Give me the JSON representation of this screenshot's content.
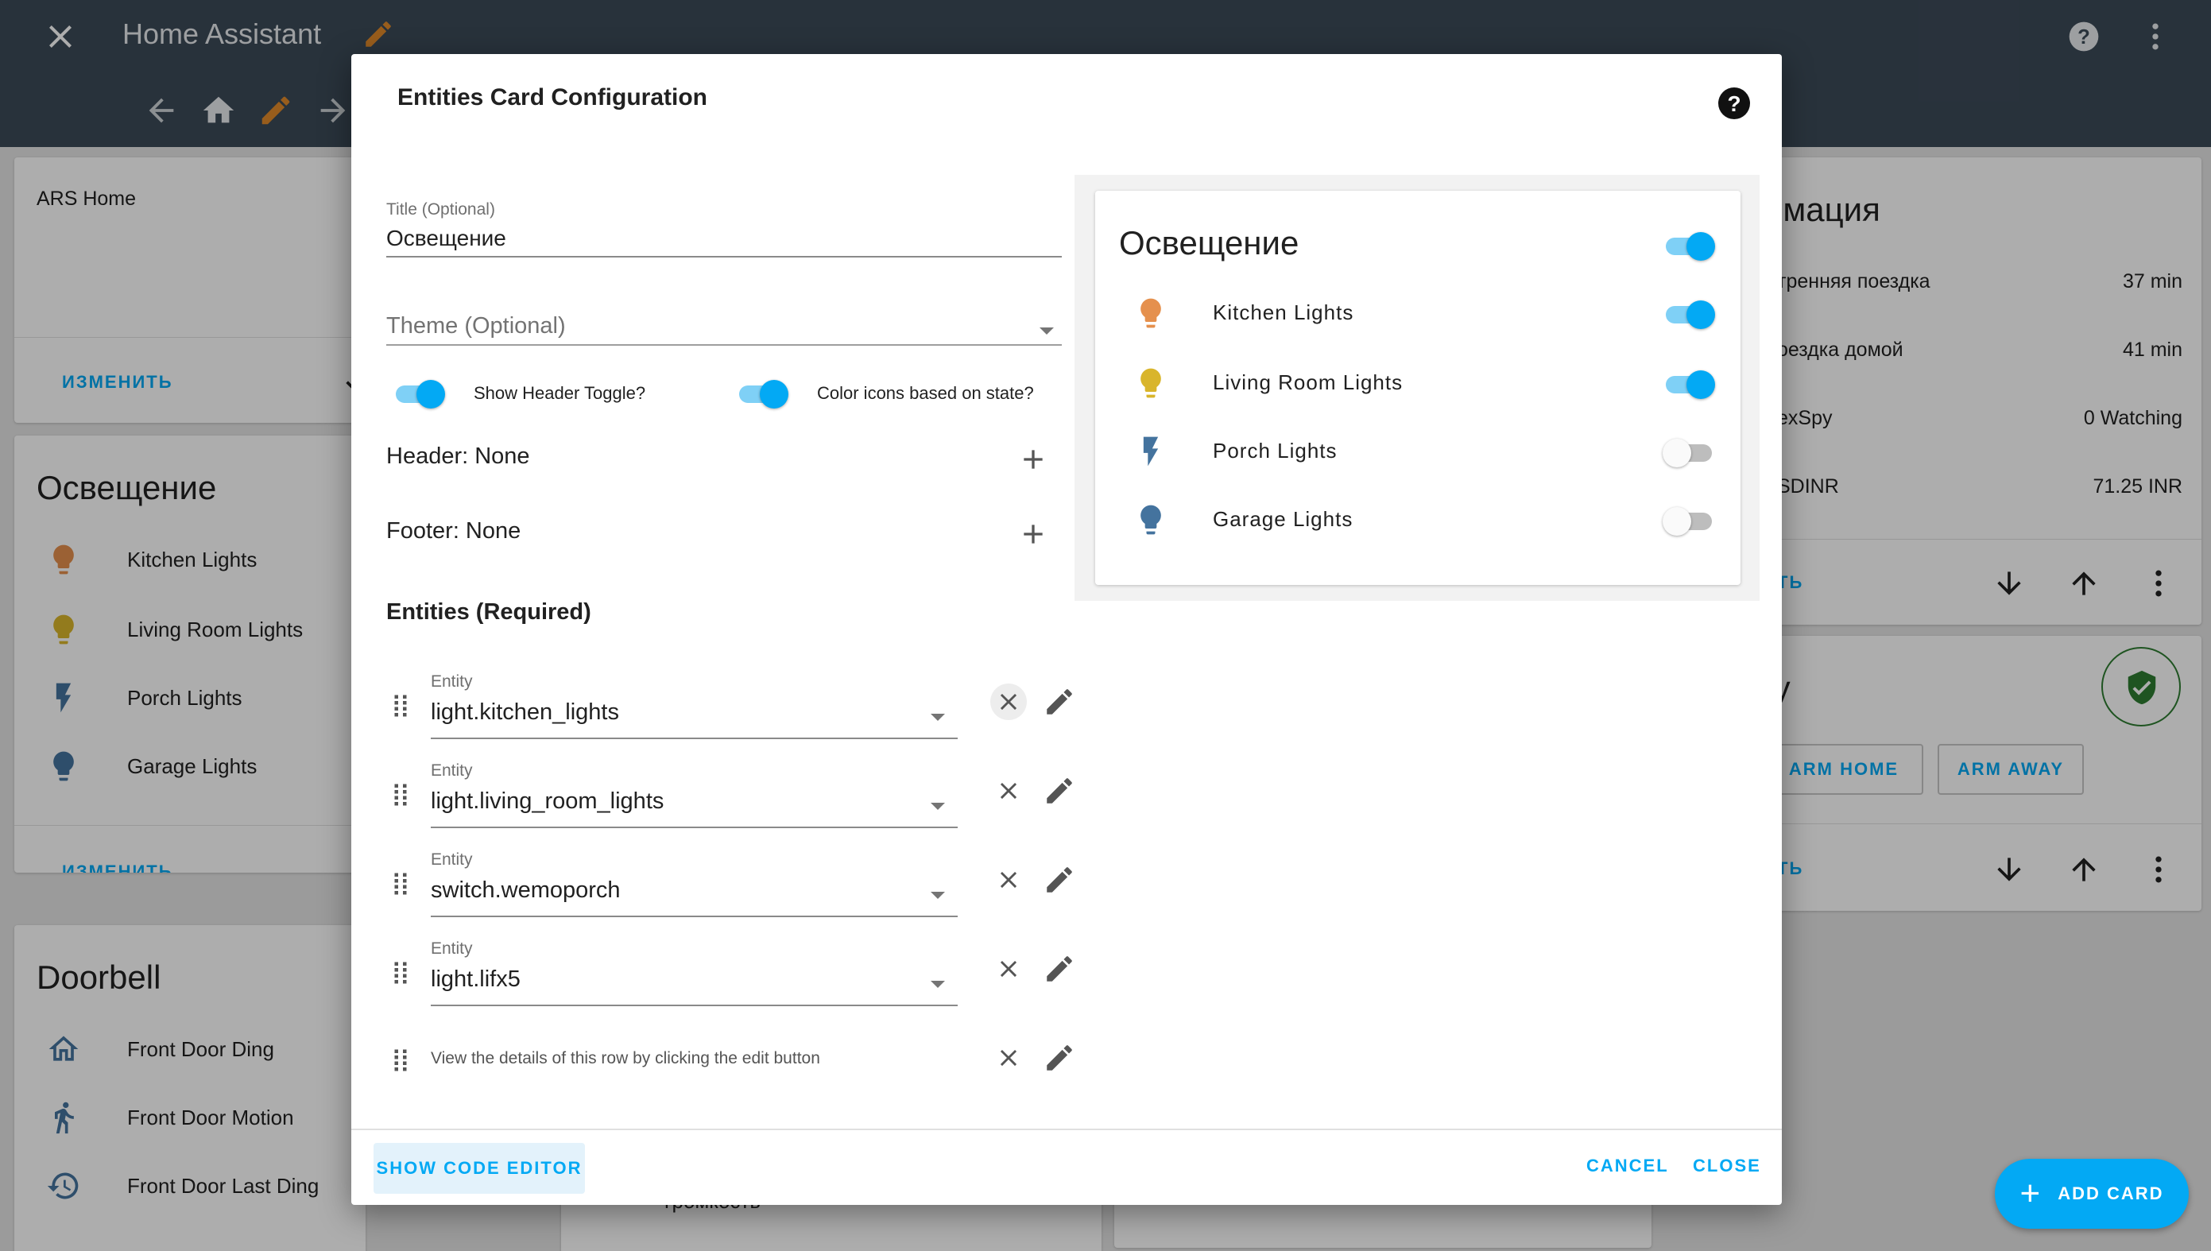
{
  "app": {
    "title": "Home Assistant"
  },
  "background": {
    "left_col": {
      "ars_home": "ARS Home",
      "change_label": "ИЗМЕНИТЬ",
      "lights_card": {
        "title": "Освещение",
        "rows": [
          "Kitchen Lights",
          "Living Room Lights",
          "Porch Lights",
          "Garage Lights"
        ]
      },
      "doorbell_card": {
        "title": "Doorbell",
        "rows": [
          "Front Door Ding",
          "Front Door Motion",
          "Front Door Last Ding"
        ]
      },
      "volume_label": "громкость",
      "change_label_2": "ИЗМЕНИТЬ"
    },
    "right_col": {
      "heading": "омация",
      "rows": [
        {
          "label": "тренняя поездка",
          "value": "37 min"
        },
        {
          "label": "оездка домой",
          "value": "41 min"
        },
        {
          "label": "exSpy",
          "value": "0 Watching"
        },
        {
          "label": "SDINR",
          "value": "71.25 INR"
        }
      ],
      "link_a": "ТЬ",
      "security_heading": "ty",
      "arm_home": "ARM HOME",
      "arm_away": "ARM AWAY",
      "link_b": "ТЬ"
    },
    "fab_label": "ADD CARD"
  },
  "dialog": {
    "title": "Entities Card Configuration",
    "title_field": {
      "label": "Title (Optional)",
      "value": "Освещение"
    },
    "theme_field": {
      "placeholder": "Theme (Optional)"
    },
    "show_header_toggle_label": "Show Header Toggle?",
    "color_icons_label": "Color icons based on state?",
    "header_label": "Header: None",
    "footer_label": "Footer: None",
    "entities_heading": "Entities (Required)",
    "entity_label": "Entity",
    "entities": [
      {
        "value": "light.kitchen_lights"
      },
      {
        "value": "light.living_room_lights"
      },
      {
        "value": "switch.wemoporch"
      },
      {
        "value": "light.lifx5"
      }
    ],
    "edit_hint": "View the details of this row by clicking the edit button",
    "show_code_editor": "SHOW CODE EDITOR",
    "cancel": "CANCEL",
    "close": "CLOSE"
  },
  "preview": {
    "title": "Освещение",
    "rows": [
      {
        "label": "Kitchen Lights",
        "on": true,
        "icon": "bulb-icon",
        "color": "#e5904d"
      },
      {
        "label": "Living Room Lights",
        "on": true,
        "icon": "bulb-icon",
        "color": "#d9b52b"
      },
      {
        "label": "Porch Lights",
        "on": false,
        "icon": "flash-icon",
        "color": "#44739e"
      },
      {
        "label": "Garage Lights",
        "on": false,
        "icon": "bulb-icon",
        "color": "#44739e"
      }
    ]
  },
  "colors": {
    "accent": "#03a9f4",
    "header_bg": "#3c4a58",
    "inactive_icon": "#44739e"
  }
}
